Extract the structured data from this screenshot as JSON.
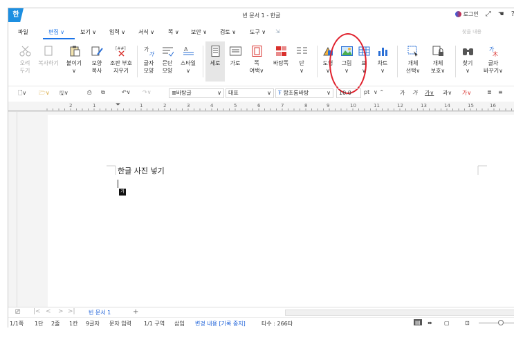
{
  "title": "빈 문서 1 - 한글",
  "app_logo": "한",
  "titlebar_right": {
    "login": "로그인"
  },
  "menu": {
    "items": [
      "파일",
      "편집 ∨",
      "보기 ∨",
      "입력 ∨",
      "서식 ∨",
      "쪽 ∨",
      "보안 ∨",
      "검토 ∨",
      "도구 ∨"
    ],
    "search_placeholder": "찾을 내용"
  },
  "ribbon": {
    "cut": [
      "오려",
      "두기"
    ],
    "copy": "복사하기",
    "paste": "붙이기",
    "shape_copy": [
      "모양",
      "복사"
    ],
    "clear": [
      "조판 부호",
      "지우기"
    ],
    "char_shape": [
      "글자",
      "모양"
    ],
    "para_shape": [
      "문단",
      "모양"
    ],
    "style": [
      "스타일",
      "∨"
    ],
    "portrait": "세로",
    "landscape": "가로",
    "margins": [
      "쪽",
      "여백∨"
    ],
    "background": [
      "바탕쪽",
      ""
    ],
    "columns": [
      "단",
      "∨"
    ],
    "shapes": [
      "도형",
      "∨"
    ],
    "picture": [
      "그림",
      "∨"
    ],
    "table": [
      "표",
      "∨"
    ],
    "chart": [
      "차트",
      "∨"
    ],
    "obj_select": [
      "개체",
      "선택∨"
    ],
    "obj_protect": [
      "개체",
      "보호∨"
    ],
    "find": [
      "찾기",
      "∨"
    ],
    "replace": [
      "글자",
      "바꾸기∨"
    ]
  },
  "format": {
    "style_value": "바탕글",
    "lang_value": "대표",
    "font_value": "함초롬바탕",
    "size_value": "10.0",
    "size_unit": "pt"
  },
  "ruler_numbers": [
    "2",
    "1",
    "1",
    "2",
    "3",
    "4",
    "5",
    "6",
    "7",
    "8",
    "9",
    "10",
    "11",
    "12",
    "13",
    "14",
    "15",
    "16"
  ],
  "document": {
    "text": "한글 사진 넣기",
    "ime": "가"
  },
  "tabs": {
    "active": "빈 문서 1",
    "add": "+"
  },
  "status": {
    "page": "1/1쪽",
    "col": "1단",
    "line": "2줄",
    "char": "1칸",
    "count": "9글자",
    "mode": "문자 입력",
    "section": "1/1 구역",
    "insert": "삽입",
    "track": "변경 내용 [기록 중지]",
    "strokes": "타수 : 266타"
  },
  "colors": {
    "accent": "#1a73e8",
    "logo": "#1d8fe1",
    "highlight": "#e0202c"
  }
}
